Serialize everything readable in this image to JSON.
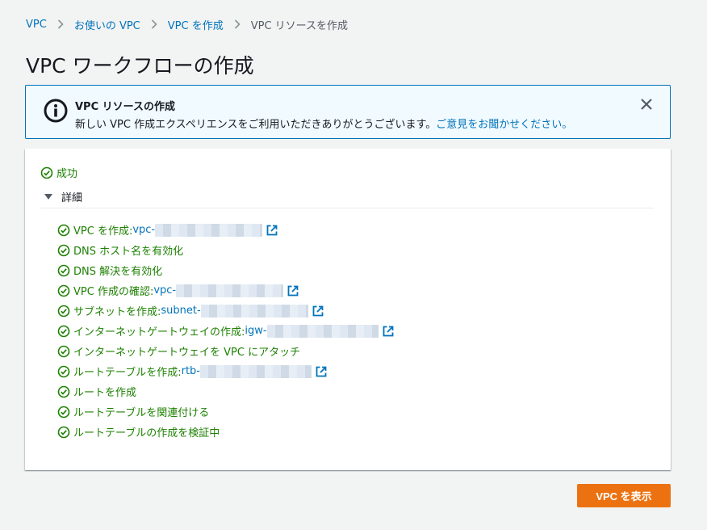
{
  "breadcrumb": {
    "items": [
      {
        "label": "VPC"
      },
      {
        "label": "お使いの VPC"
      },
      {
        "label": "VPC を作成"
      }
    ],
    "current": "VPC リソースを作成"
  },
  "page_title": "VPC ワークフローの作成",
  "banner": {
    "title": "VPC リソースの作成",
    "text": "新しい VPC 作成エクスペリエンスをご利用いただきありがとうございます。",
    "link": "ご意見をお聞かせください。"
  },
  "status": {
    "label": "成功",
    "color": "#1d8102"
  },
  "details": {
    "label": "詳細",
    "steps": [
      {
        "text": "VPC を作成: ",
        "link": "vpc-"
      },
      {
        "text": "DNS ホスト名を有効化"
      },
      {
        "text": "DNS 解決を有効化"
      },
      {
        "text": "VPC 作成の確認: ",
        "link": "vpc-"
      },
      {
        "text": "サブネットを作成: ",
        "link": "subnet-"
      },
      {
        "text": "インターネットゲートウェイの作成: ",
        "link": "igw-"
      },
      {
        "text": "インターネットゲートウェイを VPC にアタッチ"
      },
      {
        "text": "ルートテーブルを作成: ",
        "link": "rtb-"
      },
      {
        "text": "ルートを作成"
      },
      {
        "text": "ルートテーブルを関連付ける"
      },
      {
        "text": "ルートテーブルの作成を検証中"
      }
    ]
  },
  "footer": {
    "primary_button": "VPC を表示"
  },
  "colors": {
    "accent": "#0073bb",
    "success": "#1d8102",
    "primary": "#ec7211"
  }
}
